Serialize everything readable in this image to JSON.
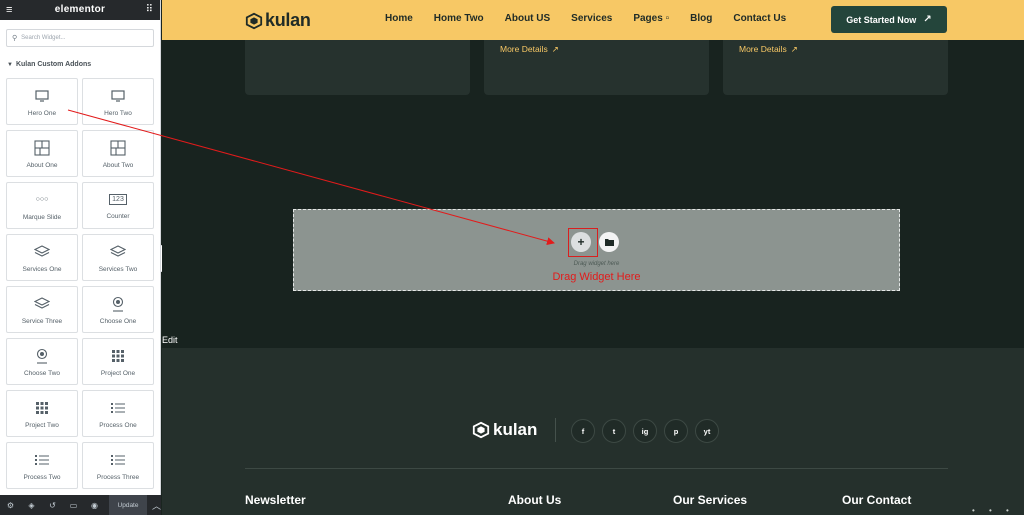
{
  "panel": {
    "menu_glyph": "≡",
    "title": "elementor",
    "grid_glyph": "⠿",
    "search_placeholder": "Search Widget...",
    "category": "Kulan Custom Addons",
    "widgets": [
      {
        "label": "Hero One",
        "icon": "monitor-icon"
      },
      {
        "label": "Hero Two",
        "icon": "monitor-icon"
      },
      {
        "label": "About One",
        "icon": "layout-icon"
      },
      {
        "label": "About Two",
        "icon": "layout-icon"
      },
      {
        "label": "Marque Slide",
        "icon": "dots-icon"
      },
      {
        "label": "Counter",
        "icon": "counter-icon"
      },
      {
        "label": "Services One",
        "icon": "layers-icon"
      },
      {
        "label": "Services Two",
        "icon": "layers-icon"
      },
      {
        "label": "Service Three",
        "icon": "layers-icon"
      },
      {
        "label": "Choose One",
        "icon": "badge-icon"
      },
      {
        "label": "Choose Two",
        "icon": "badge-icon"
      },
      {
        "label": "Project One",
        "icon": "grid-icon"
      },
      {
        "label": "Project Two",
        "icon": "grid-icon"
      },
      {
        "label": "Process One",
        "icon": "list-icon"
      },
      {
        "label": "Process Two",
        "icon": "list-icon"
      },
      {
        "label": "Process Three",
        "icon": "list-icon"
      }
    ],
    "counter_text": "123",
    "marque_text": "○○○",
    "footer": {
      "update_label": "Update",
      "collapse_glyph": "‹"
    }
  },
  "header": {
    "logo_text": "kulan",
    "nav": [
      "Home",
      "Home Two",
      "About US",
      "Services",
      "Pages",
      "Blog",
      "Contact Us"
    ],
    "pages_caret": "▫",
    "cta_label": "Get Started Now",
    "cta_arrow": "↗"
  },
  "cards": [
    {
      "more": "More Details",
      "arrow": "↗"
    },
    {
      "more": "More Details",
      "arrow": "↗"
    }
  ],
  "dropzone": {
    "add_glyph": "+",
    "hint": "Drag widget here",
    "annotation": "Drag Widget Here"
  },
  "edit_label": "Edit",
  "footer": {
    "logo_text": "kulan",
    "socials": [
      "f",
      "t",
      "ig",
      "p",
      "yt"
    ],
    "headings": [
      "Newsletter",
      "About Us",
      "Our Services",
      "Our Contact"
    ],
    "dots": "• • •"
  },
  "colors": {
    "header_bg": "#f7c865",
    "cta_bg": "#24453b",
    "dark_bg": "#18231f",
    "accent_yellow": "#f7c865",
    "annotation_red": "#e21b1b"
  }
}
